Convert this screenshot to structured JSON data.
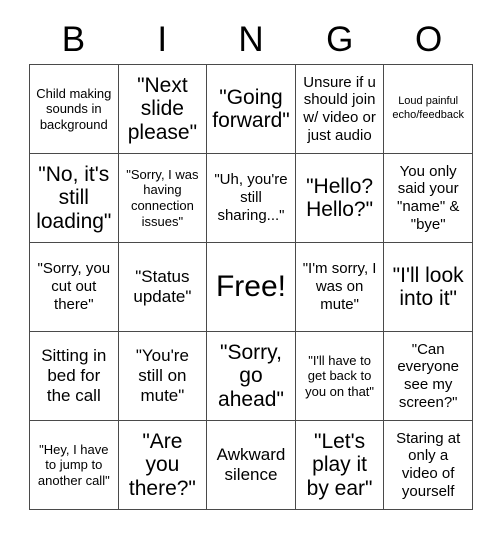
{
  "card": {
    "header_letters": [
      "B",
      "I",
      "N",
      "G",
      "O"
    ],
    "free_space": "Free!",
    "border_color": "#4a4a4a",
    "background_color": "#ffffff",
    "text_color": "#000000",
    "rows": [
      [
        {
          "text": "Child making sounds in background",
          "size": "sz-s"
        },
        {
          "text": "\"Next slide please\"",
          "size": "sz-xl"
        },
        {
          "text": "\"Going forward\"",
          "size": "sz-xl"
        },
        {
          "text": "Unsure if u should join w/ video or just audio",
          "size": "sz-m"
        },
        {
          "text": "Loud painful echo/feedback",
          "size": "sz-xs"
        }
      ],
      [
        {
          "text": "\"No, it's still loading\"",
          "size": "sz-xl"
        },
        {
          "text": "\"Sorry, I was having connection issues\"",
          "size": "sz-s"
        },
        {
          "text": "\"Uh, you're still sharing...\"",
          "size": "sz-m"
        },
        {
          "text": "\"Hello? Hello?\"",
          "size": "sz-xl"
        },
        {
          "text": "You only said your \"name\" & \"bye\"",
          "size": "sz-m"
        }
      ],
      [
        {
          "text": "\"Sorry, you cut out there\"",
          "size": "sz-m"
        },
        {
          "text": "\"Status update\"",
          "size": "sz-l"
        },
        {
          "text": "Free!",
          "size": "sz-xxl"
        },
        {
          "text": "\"I'm sorry, I was on mute\"",
          "size": "sz-m"
        },
        {
          "text": "\"I'll look into it\"",
          "size": "sz-xl"
        }
      ],
      [
        {
          "text": "Sitting in bed for the call",
          "size": "sz-l"
        },
        {
          "text": "\"You're still on mute\"",
          "size": "sz-l"
        },
        {
          "text": "\"Sorry, go ahead\"",
          "size": "sz-xl"
        },
        {
          "text": "\"I'll have to get back to you on that\"",
          "size": "sz-s"
        },
        {
          "text": "\"Can everyone see my screen?\"",
          "size": "sz-m"
        }
      ],
      [
        {
          "text": "\"Hey, I have to jump to another call\"",
          "size": "sz-s"
        },
        {
          "text": "\"Are you there?\"",
          "size": "sz-xl"
        },
        {
          "text": "Awkward silence",
          "size": "sz-l"
        },
        {
          "text": "\"Let's play it by ear\"",
          "size": "sz-xl"
        },
        {
          "text": "Staring at only a video of yourself",
          "size": "sz-m"
        }
      ]
    ]
  }
}
